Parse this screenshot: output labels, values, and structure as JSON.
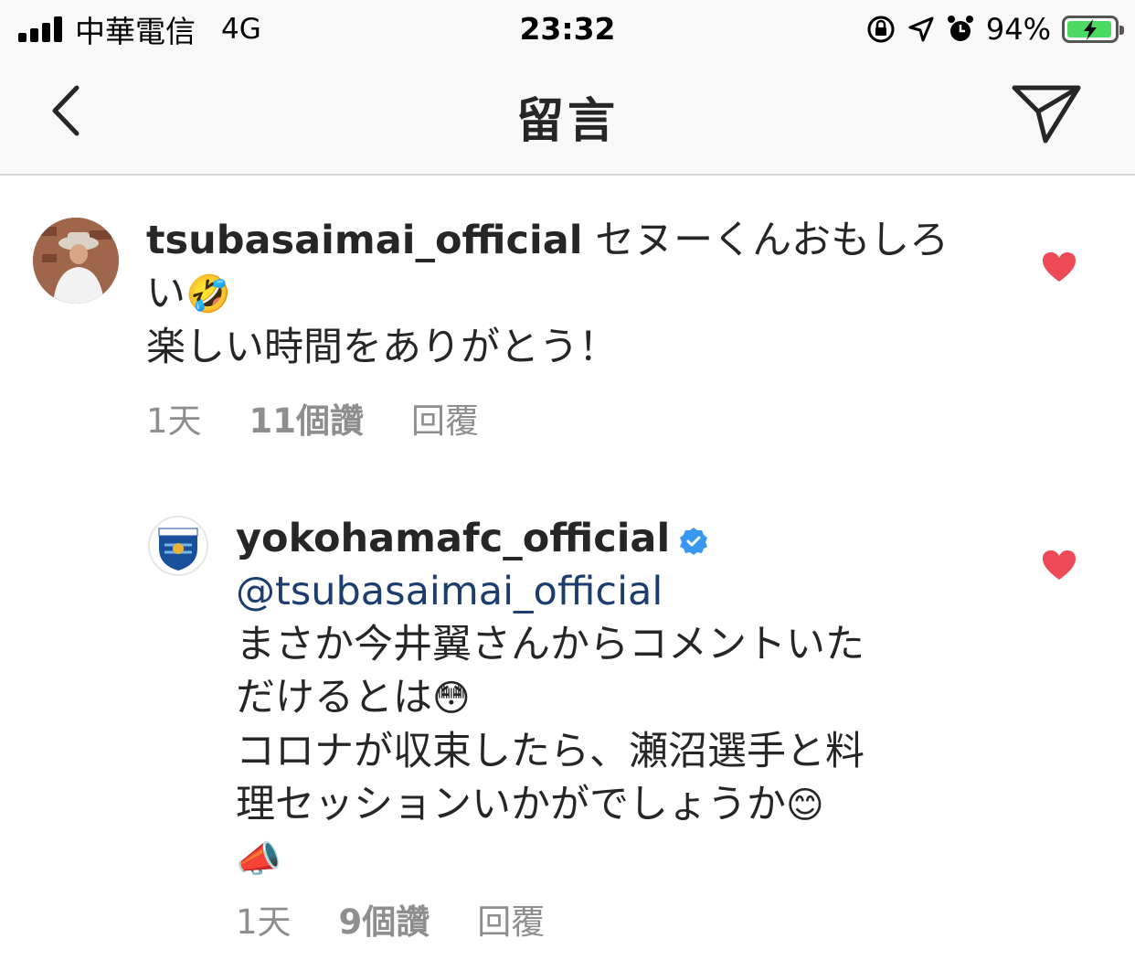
{
  "status_bar": {
    "carrier": "中華電信",
    "network": "4G",
    "time": "23:32",
    "battery_percent": "94%",
    "icons": [
      "signal-icon",
      "orientation-lock-icon",
      "location-icon",
      "alarm-icon",
      "battery-charging-icon"
    ]
  },
  "nav": {
    "title": "留言",
    "back_icon": "chevron-left-icon",
    "share_icon": "paper-plane-icon"
  },
  "comments": [
    {
      "username": "tsubasaimai_official",
      "text_line1": " セヌーくんおもしろ",
      "text_line2": "い",
      "emoji_1": "🤣",
      "text_line3": "楽しい時間をありがとう！",
      "time": "1天",
      "likes": "11個讚",
      "reply": "回覆",
      "liked": true
    },
    {
      "username": "yokohamafc_official",
      "verified": true,
      "mention": "@tsubasaimai_official",
      "text_line1": "まさか今井翼さんからコメントいた",
      "text_line2": "だけるとは",
      "emoji_1": "😳",
      "text_line3": "コロナが収束したら、瀬沼選手と料",
      "text_line4": "理セッションいかがでしょうか",
      "emoji_2": "😊",
      "emoji_3": "📣",
      "time": "1天",
      "likes": "9個讚",
      "reply": "回覆",
      "liked": true
    }
  ],
  "colors": {
    "heart": "#ed4956",
    "mention": "#1c3e6e",
    "meta": "#8e8e8e",
    "verified": "#3897f0"
  }
}
